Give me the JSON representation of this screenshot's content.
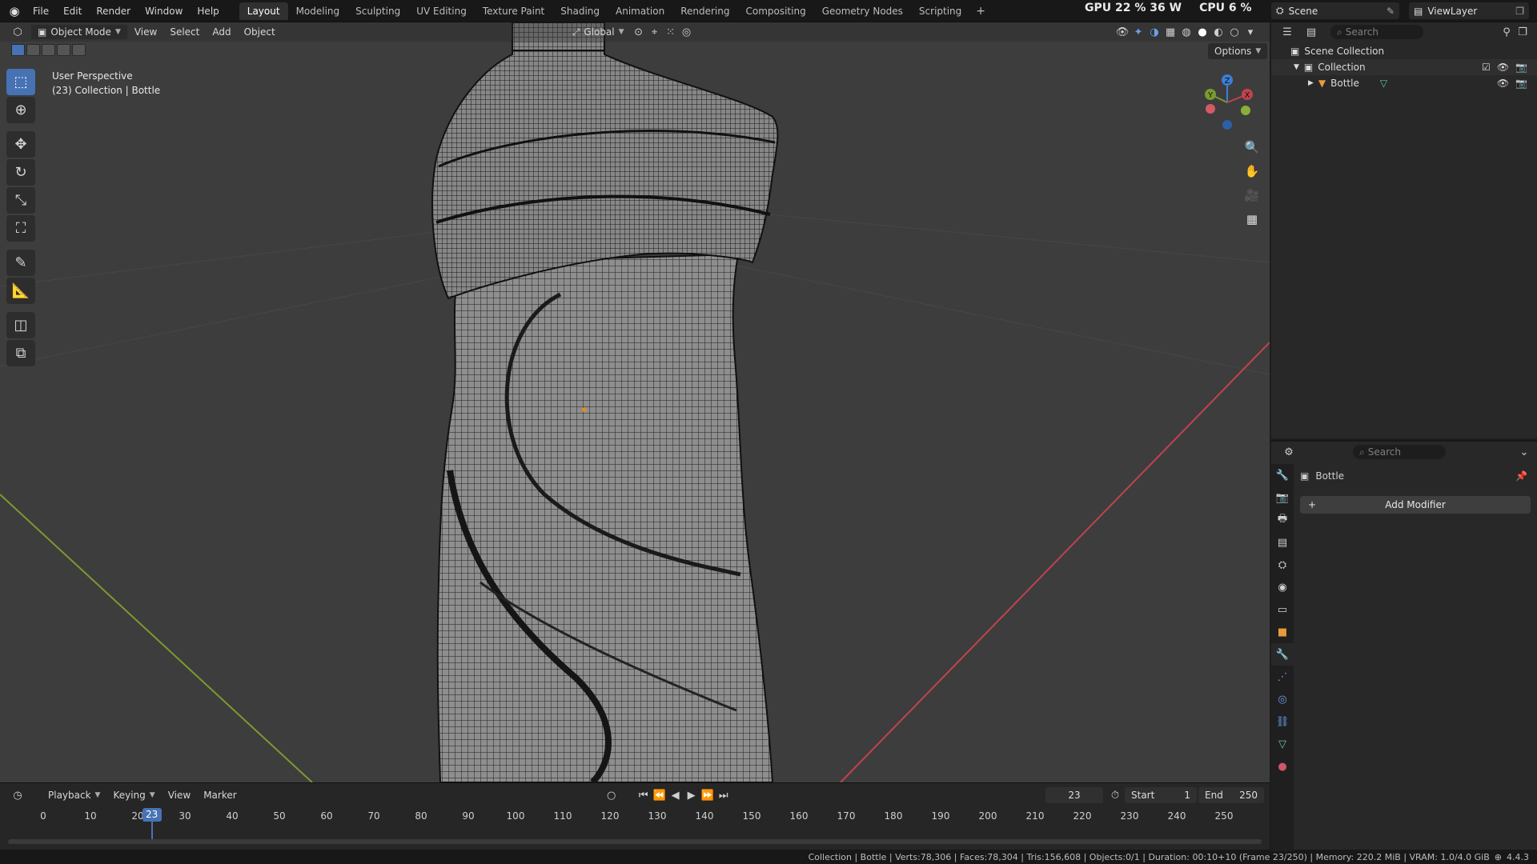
{
  "topbar": {
    "menus": [
      "File",
      "Edit",
      "Render",
      "Window",
      "Help"
    ],
    "workspaces": [
      "Layout",
      "Modeling",
      "Sculpting",
      "UV Editing",
      "Texture Paint",
      "Shading",
      "Animation",
      "Rendering",
      "Compositing",
      "Geometry Nodes",
      "Scripting"
    ],
    "active_workspace": "Layout",
    "gpu_label": "GPU",
    "gpu_value": "22 %",
    "gpu_power": "36 W",
    "cpu_label": "CPU",
    "cpu_value": "6 %",
    "scene_name": "Scene",
    "view_layer": "ViewLayer"
  },
  "viewport": {
    "mode": "Object Mode",
    "menus": [
      "View",
      "Select",
      "Add",
      "Object"
    ],
    "transform_orientation": "Global",
    "options_label": "Options",
    "perspective_label": "User Perspective",
    "context_label": "(23) Collection | Bottle",
    "gizmo_axes": [
      "Z",
      "Y",
      "X"
    ]
  },
  "outliner": {
    "search_placeholder": "Search",
    "scene_collection": "Scene Collection",
    "collection": "Collection",
    "object": "Bottle"
  },
  "properties": {
    "search_placeholder": "Search",
    "object_name": "Bottle",
    "add_modifier": "Add Modifier"
  },
  "timeline": {
    "menus": [
      "Playback",
      "Keying",
      "View",
      "Marker"
    ],
    "current_frame": "23",
    "start_label": "Start",
    "start_value": "1",
    "end_label": "End",
    "end_value": "250",
    "ticks": [
      "0",
      "10",
      "20",
      "30",
      "40",
      "50",
      "60",
      "70",
      "80",
      "90",
      "100",
      "110",
      "120",
      "130",
      "140",
      "150",
      "160",
      "170",
      "180",
      "190",
      "200",
      "210",
      "220",
      "230",
      "240",
      "250"
    ]
  },
  "statusbar": {
    "text": "Collection | Bottle | Verts:78,306 | Faces:78,304 | Tris:156,608 | Objects:0/1 | Duration: 00:10+10 (Frame 23/250) | Memory: 220.2 MiB | VRAM: 1.0/4.0 GiB",
    "version": "4.4.3"
  },
  "colors": {
    "accent": "#4772b3",
    "x_axis": "#c0434f",
    "y_axis": "#7a9a2e",
    "z_axis": "#3b7fd6"
  }
}
